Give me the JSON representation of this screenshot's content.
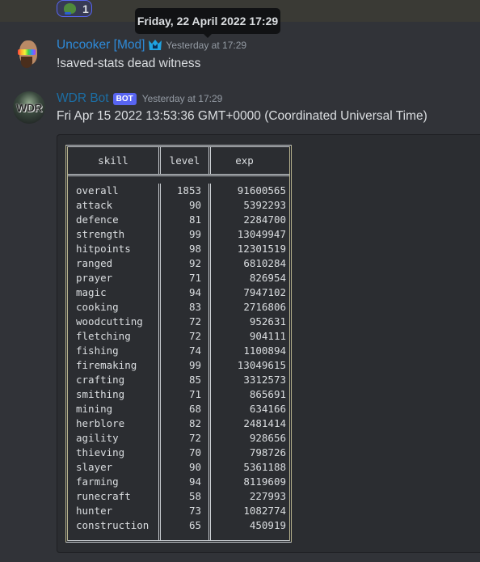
{
  "reaction": {
    "emoji": "pepe-emoji",
    "count": "1"
  },
  "tooltip": {
    "text": "Friday, 22 April 2022 17:29"
  },
  "messages": [
    {
      "username": "Uncooker [Mod]",
      "role_icon": "moderator-crown-icon",
      "timestamp": "Yesterday at 17:29",
      "text": "!saved-stats dead witness"
    },
    {
      "username": "WDR Bot",
      "tag": "BOT",
      "avatar_text": "WDR",
      "timestamp": "Yesterday at 17:29",
      "text": "Fri Apr 15 2022 13:53:36 GMT+0000 (Coordinated Universal Time)"
    }
  ],
  "table": {
    "headers": [
      "skill",
      "level",
      "exp"
    ],
    "rows": [
      [
        "overall",
        "1853",
        "91600565"
      ],
      [
        "attack",
        "90",
        "5392293"
      ],
      [
        "defence",
        "81",
        "2284700"
      ],
      [
        "strength",
        "99",
        "13049947"
      ],
      [
        "hitpoints",
        "98",
        "12301519"
      ],
      [
        "ranged",
        "92",
        "6810284"
      ],
      [
        "prayer",
        "71",
        "826954"
      ],
      [
        "magic",
        "94",
        "7947102"
      ],
      [
        "cooking",
        "83",
        "2716806"
      ],
      [
        "woodcutting",
        "72",
        "952631"
      ],
      [
        "fletching",
        "72",
        "904111"
      ],
      [
        "fishing",
        "74",
        "1100894"
      ],
      [
        "firemaking",
        "99",
        "13049615"
      ],
      [
        "crafting",
        "85",
        "3312573"
      ],
      [
        "smithing",
        "71",
        "865691"
      ],
      [
        "mining",
        "68",
        "634166"
      ],
      [
        "herblore",
        "82",
        "2481414"
      ],
      [
        "agility",
        "72",
        "928656"
      ],
      [
        "thieving",
        "70",
        "798726"
      ],
      [
        "slayer",
        "90",
        "5361188"
      ],
      [
        "farming",
        "94",
        "8119609"
      ],
      [
        "runecraft",
        "58",
        "227993"
      ],
      [
        "hunter",
        "73",
        "1082774"
      ],
      [
        "construction",
        "65",
        "450919"
      ]
    ]
  }
}
